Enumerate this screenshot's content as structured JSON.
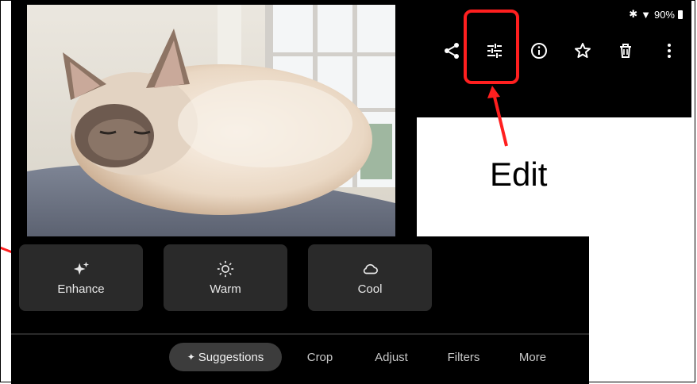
{
  "status_bar": {
    "battery": "90%"
  },
  "toolbar": {
    "icons": [
      "share-icon",
      "edit-sliders-icon",
      "info-icon",
      "star-icon",
      "trash-icon",
      "more-vert-icon"
    ]
  },
  "annotation": {
    "edit_label": "Edit",
    "highlight_color": "#ff1f1f"
  },
  "suggestions": [
    {
      "label": "Enhance",
      "icon": "sparkle-icon"
    },
    {
      "label": "Warm",
      "icon": "sun-icon"
    },
    {
      "label": "Cool",
      "icon": "cloud-icon"
    }
  ],
  "tabs": [
    {
      "label": "Suggestions",
      "active": true
    },
    {
      "label": "Crop"
    },
    {
      "label": "Adjust"
    },
    {
      "label": "Filters"
    },
    {
      "label": "More"
    }
  ]
}
